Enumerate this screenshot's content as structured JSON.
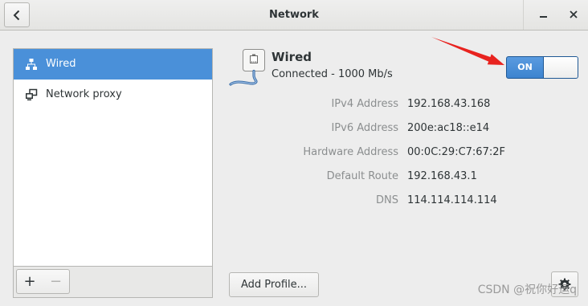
{
  "window": {
    "title": "Network"
  },
  "titlebar": {
    "back_icon": "chevron-left-icon",
    "minimize_icon": "minimize-icon",
    "close_icon": "close-icon"
  },
  "sidebar": {
    "items": [
      {
        "label": "Wired",
        "icon": "wired-network-icon",
        "selected": true
      },
      {
        "label": "Network proxy",
        "icon": "network-proxy-icon",
        "selected": false
      }
    ],
    "add_label": "+",
    "remove_label": "−"
  },
  "connection": {
    "icon": "ethernet-cable-icon",
    "name": "Wired",
    "status": "Connected - 1000 Mb/s",
    "switch_label": "ON",
    "switch_on": true
  },
  "details": [
    {
      "label": "IPv4 Address",
      "value": "192.168.43.168"
    },
    {
      "label": "IPv6 Address",
      "value": "200e:ac18::e14"
    },
    {
      "label": "Hardware Address",
      "value": "00:0C:29:C7:67:2F"
    },
    {
      "label": "Default Route",
      "value": "192.168.43.1"
    },
    {
      "label": "DNS",
      "value": "114.114.114.114"
    }
  ],
  "footer": {
    "add_profile_label": "Add Profile...",
    "settings_icon": "gear-icon"
  },
  "annotation": {
    "arrow_icon": "red-arrow-annotation"
  },
  "watermark": "CSDN @祝你好运q",
  "colors": {
    "accent": "#4a90d9",
    "annotation_arrow": "#e8231f",
    "label_text": "#8b8e8f",
    "text": "#2e3436"
  }
}
